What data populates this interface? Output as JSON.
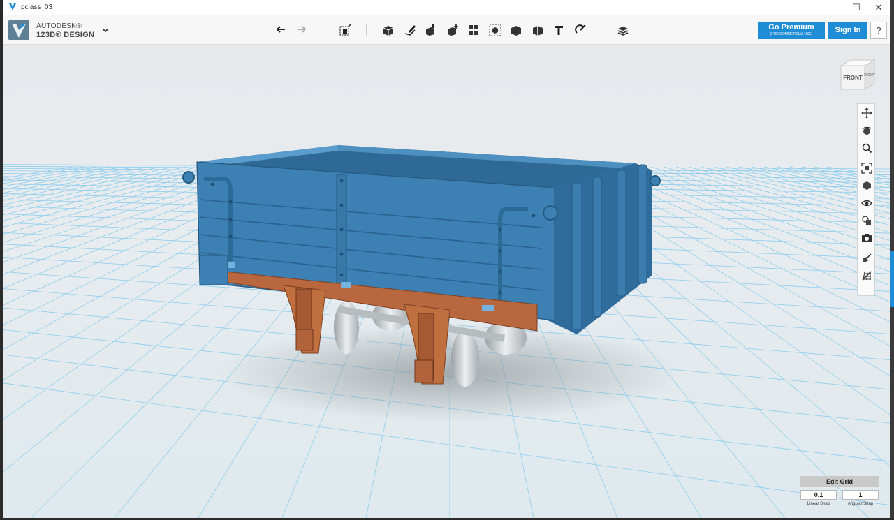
{
  "window": {
    "title": "pclass_03"
  },
  "brand": {
    "line1": "AUTODESK®",
    "line2": "123D® DESIGN"
  },
  "toolbar": {
    "tools": [
      "undo-icon",
      "redo-icon",
      "transform-icon",
      "primitives-icon",
      "sketch-icon",
      "construct-icon",
      "modify-icon",
      "pattern-icon",
      "grouping-icon",
      "combine-icon",
      "measure-icon",
      "text-icon",
      "snap-icon",
      "material-icon"
    ]
  },
  "account": {
    "premium_label": "Go Premium",
    "premium_sub": "(FOR COMMERCIAL USE)",
    "signin_label": "Sign In",
    "help_label": "?"
  },
  "viewcube": {
    "front": "FRONT",
    "right": "RIGHT"
  },
  "navbar": {
    "items": [
      "pan-icon",
      "orbit-icon",
      "zoom-icon",
      "fit-icon",
      "view-icon",
      "visibility-icon",
      "material-view-icon",
      "screenshot-icon",
      "snap-toggle-icon",
      "grid-toggle-icon"
    ]
  },
  "grid": {
    "edit_label": "Edit Grid",
    "linear_value": "0.1",
    "angular_value": "1",
    "linear_label": "Linear Snap",
    "angular_label": "Angular Snap"
  },
  "colors": {
    "accent": "#1f8dd6",
    "model_body": "#3d7fb0",
    "model_frame": "#b8673f",
    "grid_line": "#7cc4ea"
  }
}
